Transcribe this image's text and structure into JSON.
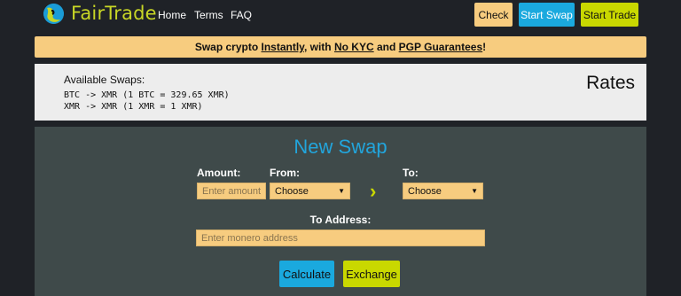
{
  "nav": {
    "brand": "FairTrade",
    "links": [
      "Home",
      "Terms",
      "FAQ"
    ],
    "buttons": {
      "check": "Check",
      "start_swap": "Start Swap",
      "start_trade": "Start Trade"
    }
  },
  "banner": {
    "part1": "Swap crypto ",
    "instantly": "Instantly",
    "part2": ", with ",
    "no_kyc": "No KYC",
    "part3": " and ",
    "pgp": "PGP Guarantees",
    "part4": "!"
  },
  "rates": {
    "available_label": "Available Swaps:",
    "lines": [
      "BTC -> XMR (1 BTC = 329.65 XMR)",
      "XMR -> XMR (1 XMR = 1 XMR)"
    ],
    "heading": "Rates"
  },
  "swap": {
    "title": "New Swap",
    "amount_label": "Amount:",
    "amount_placeholder": "Enter amount",
    "from_label": "From:",
    "from_value": "Choose",
    "to_label": "To:",
    "to_value": "Choose",
    "address_label": "To Address:",
    "address_placeholder": "Enter monero address",
    "calculate": "Calculate",
    "exchange": "Exchange"
  },
  "colors": {
    "background": "#1f2227",
    "brand": "#c8d626",
    "accent_blue": "#1aa9de",
    "accent_yellow": "#f7cc7f",
    "accent_lime": "#c9d800",
    "panel": "#3f4a4a"
  }
}
